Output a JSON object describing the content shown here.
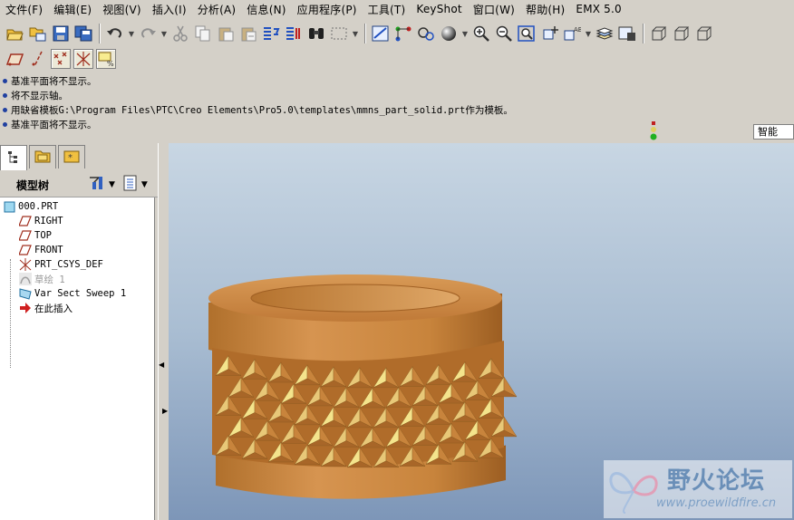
{
  "menu": [
    "文件(F)",
    "编辑(E)",
    "视图(V)",
    "插入(I)",
    "分析(A)",
    "信息(N)",
    "应用程序(P)",
    "工具(T)",
    "KeyShot",
    "窗口(W)",
    "帮助(H)",
    "EMX 5.0"
  ],
  "toolbar1_icons": [
    "open-icon",
    "open-session-icon",
    "save-icon",
    "save-as-icon",
    "undo-icon",
    "redo-icon",
    "cut-icon",
    "copy-icon",
    "paste-icon",
    "paste-special-icon",
    "regenerate-icon",
    "regenerate-manager-icon",
    "find-icon",
    "select-box-icon",
    "view-manager-icon",
    "relations-icon",
    "model-player-icon",
    "appearance-icon",
    "zoom-in-icon",
    "zoom-out-icon",
    "refit-icon",
    "reorient-icon",
    "saved-views-icon",
    "layers-icon",
    "view-display-icon",
    "wireframe-icon",
    "hidden-line-icon",
    "no-hidden-icon"
  ],
  "toolbar2_icons": [
    "datum-plane-display-icon",
    "datum-axis-display-icon",
    "datum-point-display-icon",
    "csys-display-icon",
    "annotation-display-icon"
  ],
  "messages": [
    "基准平面将不显示。",
    "将不显示轴。",
    "用缺省模板G:\\Program Files\\PTC\\Creo Elements\\Pro5.0\\templates\\mmns_part_solid.prt作为模板。",
    "基准平面将不显示。"
  ],
  "filter": {
    "value": "智能"
  },
  "model_tree": {
    "title": "模型树",
    "items": [
      {
        "label": "000.PRT",
        "icon": "part-icon",
        "dim": false
      },
      {
        "label": "RIGHT",
        "icon": "datum-plane-icon",
        "dim": false
      },
      {
        "label": "TOP",
        "icon": "datum-plane-icon",
        "dim": false
      },
      {
        "label": "FRONT",
        "icon": "datum-plane-icon",
        "dim": false
      },
      {
        "label": "PRT_CSYS_DEF",
        "icon": "csys-icon",
        "dim": false
      },
      {
        "label": "草绘 1",
        "icon": "sketch-icon",
        "dim": true
      },
      {
        "label": "Var Sect Sweep 1",
        "icon": "sweep-icon",
        "dim": false
      },
      {
        "label": "在此插入",
        "icon": "insert-here-icon",
        "dim": false
      }
    ]
  },
  "colors": {
    "model_face": "#c8843c",
    "model_highlight": "#f4e48c",
    "background_top": "#c8d6e3",
    "background_bottom": "#7d96b8"
  },
  "watermark": {
    "title": "野火论坛",
    "url": "www.proewildfire.cn"
  }
}
